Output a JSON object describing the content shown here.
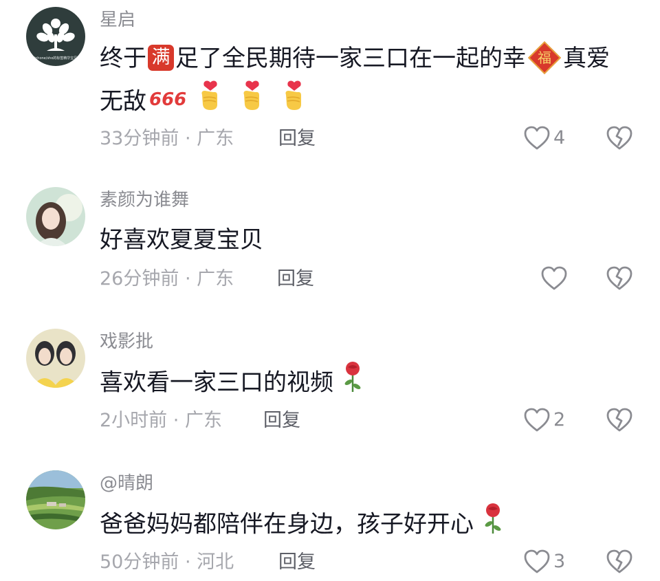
{
  "comments": [
    {
      "username": "星启",
      "text_parts": [
        "终于",
        "满",
        "足了全民期待一家三口在一起的幸",
        "福",
        "真爱",
        "无敌",
        "666"
      ],
      "time": "33分钟前",
      "location": "广东",
      "reply_label": "回复",
      "likes": "4",
      "avatar_text": "iphone/sho的标签精华宝贝"
    },
    {
      "username": "素颜为谁舞",
      "text": "好喜欢夏夏宝贝",
      "time": "26分钟前",
      "location": "广东",
      "reply_label": "回复",
      "likes": ""
    },
    {
      "username": "戏影批",
      "text": "喜欢看一家三口的视频",
      "time": "2小时前",
      "location": "广东",
      "reply_label": "回复",
      "likes": "2"
    },
    {
      "username": "@晴朗",
      "text": "爸爸妈妈都陪伴在身边，孩子好开心",
      "time": "50分钟前",
      "location": "河北",
      "reply_label": "回复",
      "likes": "3"
    }
  ],
  "separator": "·",
  "icons": {
    "like": "heart-outline-icon",
    "dislike": "broken-heart-icon",
    "heart_hands": "finger-heart-emoji",
    "rose": "rose-emoji"
  }
}
